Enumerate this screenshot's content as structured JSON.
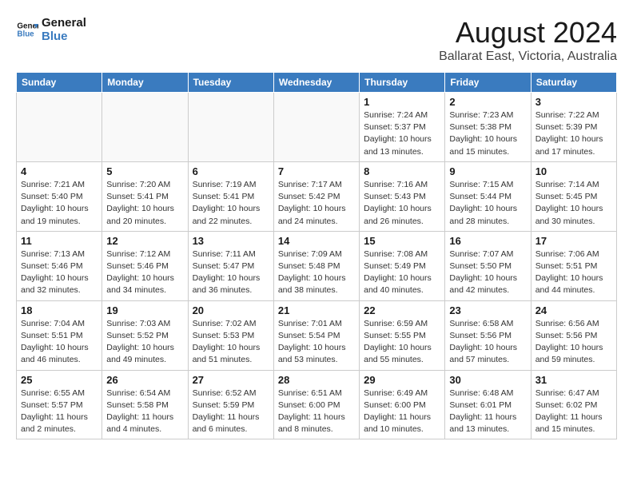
{
  "header": {
    "logo_line1": "General",
    "logo_line2": "Blue",
    "title": "August 2024",
    "subtitle": "Ballarat East, Victoria, Australia"
  },
  "columns": [
    "Sunday",
    "Monday",
    "Tuesday",
    "Wednesday",
    "Thursday",
    "Friday",
    "Saturday"
  ],
  "weeks": [
    [
      {
        "day": "",
        "info": ""
      },
      {
        "day": "",
        "info": ""
      },
      {
        "day": "",
        "info": ""
      },
      {
        "day": "",
        "info": ""
      },
      {
        "day": "1",
        "info": "Sunrise: 7:24 AM\nSunset: 5:37 PM\nDaylight: 10 hours\nand 13 minutes."
      },
      {
        "day": "2",
        "info": "Sunrise: 7:23 AM\nSunset: 5:38 PM\nDaylight: 10 hours\nand 15 minutes."
      },
      {
        "day": "3",
        "info": "Sunrise: 7:22 AM\nSunset: 5:39 PM\nDaylight: 10 hours\nand 17 minutes."
      }
    ],
    [
      {
        "day": "4",
        "info": "Sunrise: 7:21 AM\nSunset: 5:40 PM\nDaylight: 10 hours\nand 19 minutes."
      },
      {
        "day": "5",
        "info": "Sunrise: 7:20 AM\nSunset: 5:41 PM\nDaylight: 10 hours\nand 20 minutes."
      },
      {
        "day": "6",
        "info": "Sunrise: 7:19 AM\nSunset: 5:41 PM\nDaylight: 10 hours\nand 22 minutes."
      },
      {
        "day": "7",
        "info": "Sunrise: 7:17 AM\nSunset: 5:42 PM\nDaylight: 10 hours\nand 24 minutes."
      },
      {
        "day": "8",
        "info": "Sunrise: 7:16 AM\nSunset: 5:43 PM\nDaylight: 10 hours\nand 26 minutes."
      },
      {
        "day": "9",
        "info": "Sunrise: 7:15 AM\nSunset: 5:44 PM\nDaylight: 10 hours\nand 28 minutes."
      },
      {
        "day": "10",
        "info": "Sunrise: 7:14 AM\nSunset: 5:45 PM\nDaylight: 10 hours\nand 30 minutes."
      }
    ],
    [
      {
        "day": "11",
        "info": "Sunrise: 7:13 AM\nSunset: 5:46 PM\nDaylight: 10 hours\nand 32 minutes."
      },
      {
        "day": "12",
        "info": "Sunrise: 7:12 AM\nSunset: 5:46 PM\nDaylight: 10 hours\nand 34 minutes."
      },
      {
        "day": "13",
        "info": "Sunrise: 7:11 AM\nSunset: 5:47 PM\nDaylight: 10 hours\nand 36 minutes."
      },
      {
        "day": "14",
        "info": "Sunrise: 7:09 AM\nSunset: 5:48 PM\nDaylight: 10 hours\nand 38 minutes."
      },
      {
        "day": "15",
        "info": "Sunrise: 7:08 AM\nSunset: 5:49 PM\nDaylight: 10 hours\nand 40 minutes."
      },
      {
        "day": "16",
        "info": "Sunrise: 7:07 AM\nSunset: 5:50 PM\nDaylight: 10 hours\nand 42 minutes."
      },
      {
        "day": "17",
        "info": "Sunrise: 7:06 AM\nSunset: 5:51 PM\nDaylight: 10 hours\nand 44 minutes."
      }
    ],
    [
      {
        "day": "18",
        "info": "Sunrise: 7:04 AM\nSunset: 5:51 PM\nDaylight: 10 hours\nand 46 minutes."
      },
      {
        "day": "19",
        "info": "Sunrise: 7:03 AM\nSunset: 5:52 PM\nDaylight: 10 hours\nand 49 minutes."
      },
      {
        "day": "20",
        "info": "Sunrise: 7:02 AM\nSunset: 5:53 PM\nDaylight: 10 hours\nand 51 minutes."
      },
      {
        "day": "21",
        "info": "Sunrise: 7:01 AM\nSunset: 5:54 PM\nDaylight: 10 hours\nand 53 minutes."
      },
      {
        "day": "22",
        "info": "Sunrise: 6:59 AM\nSunset: 5:55 PM\nDaylight: 10 hours\nand 55 minutes."
      },
      {
        "day": "23",
        "info": "Sunrise: 6:58 AM\nSunset: 5:56 PM\nDaylight: 10 hours\nand 57 minutes."
      },
      {
        "day": "24",
        "info": "Sunrise: 6:56 AM\nSunset: 5:56 PM\nDaylight: 10 hours\nand 59 minutes."
      }
    ],
    [
      {
        "day": "25",
        "info": "Sunrise: 6:55 AM\nSunset: 5:57 PM\nDaylight: 11 hours\nand 2 minutes."
      },
      {
        "day": "26",
        "info": "Sunrise: 6:54 AM\nSunset: 5:58 PM\nDaylight: 11 hours\nand 4 minutes."
      },
      {
        "day": "27",
        "info": "Sunrise: 6:52 AM\nSunset: 5:59 PM\nDaylight: 11 hours\nand 6 minutes."
      },
      {
        "day": "28",
        "info": "Sunrise: 6:51 AM\nSunset: 6:00 PM\nDaylight: 11 hours\nand 8 minutes."
      },
      {
        "day": "29",
        "info": "Sunrise: 6:49 AM\nSunset: 6:00 PM\nDaylight: 11 hours\nand 10 minutes."
      },
      {
        "day": "30",
        "info": "Sunrise: 6:48 AM\nSunset: 6:01 PM\nDaylight: 11 hours\nand 13 minutes."
      },
      {
        "day": "31",
        "info": "Sunrise: 6:47 AM\nSunset: 6:02 PM\nDaylight: 11 hours\nand 15 minutes."
      }
    ]
  ]
}
